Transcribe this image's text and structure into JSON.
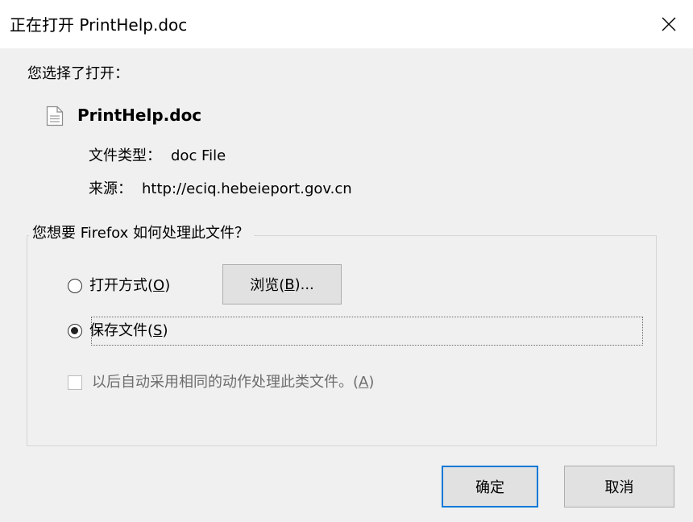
{
  "window": {
    "title": "正在打开 PrintHelp.doc"
  },
  "file_info": {
    "section_label": "您选择了打开：",
    "file_name": "PrintHelp.doc",
    "type_label": "文件类型：",
    "type_value": "doc File",
    "source_label": "来源：",
    "source_value": "http://eciq.hebeieport.gov.cn"
  },
  "action_group": {
    "legend": "您想要 Firefox 如何处理此文件？",
    "open_with": {
      "label_prefix": "打开方式(",
      "accesskey": "O",
      "label_suffix": ")",
      "checked": false
    },
    "browse_button": {
      "label_prefix": "浏览(",
      "accesskey": "B",
      "label_suffix": ")..."
    },
    "save_file": {
      "label_prefix": "保存文件(",
      "accesskey": "S",
      "label_suffix": ")",
      "checked": true
    },
    "remember_choice": {
      "label_prefix": "以后自动采用相同的动作处理此类文件。(",
      "accesskey": "A",
      "label_suffix": ")",
      "checked": false,
      "disabled": true
    }
  },
  "buttons": {
    "ok_label": "确定",
    "cancel_label": "取消"
  },
  "icons": {
    "close": "close-icon",
    "file": "document-icon"
  },
  "colors": {
    "default_button_border": "#0078d7",
    "titlebar_bg": "#ffffff",
    "dialog_bg": "#f0f0f0"
  }
}
